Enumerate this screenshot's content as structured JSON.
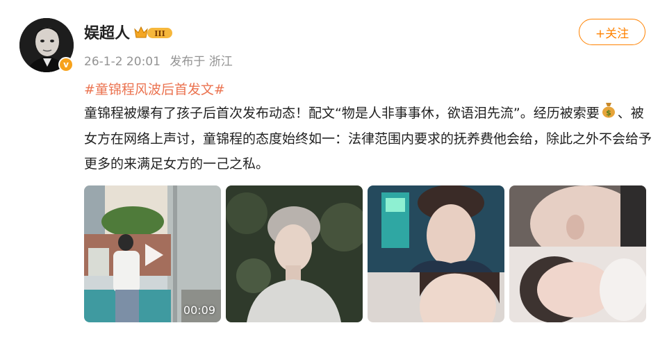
{
  "post": {
    "author": "娱超人",
    "vip_level": "III",
    "verified_mark": "v",
    "time": "26-1-2 20:01",
    "source": "发布于 浙江",
    "follow_label": "+关注",
    "topic": "#童锦程风波后首发文#",
    "text_part1": "童锦程被爆有了孩子后首次发布动态！配文“物是人非事事休，欲语泪先流”。经历被索要",
    "text_part2": "、被女方在网络上声讨，童锦程的态度始终如一：法律范围内要求的抚养费他会给，除此之外不会给予更多的来满足女方的一己之私。"
  },
  "media": {
    "video_duration": "00:09",
    "items": [
      "video",
      "portrait-photo",
      "collage-selfie-baby",
      "collage-ear-baby"
    ]
  },
  "colors": {
    "accent": "#ff8200",
    "topic": "#eb7350"
  },
  "icons": [
    "vip-level-icon",
    "verified-icon",
    "money-bag-icon",
    "play-icon"
  ]
}
